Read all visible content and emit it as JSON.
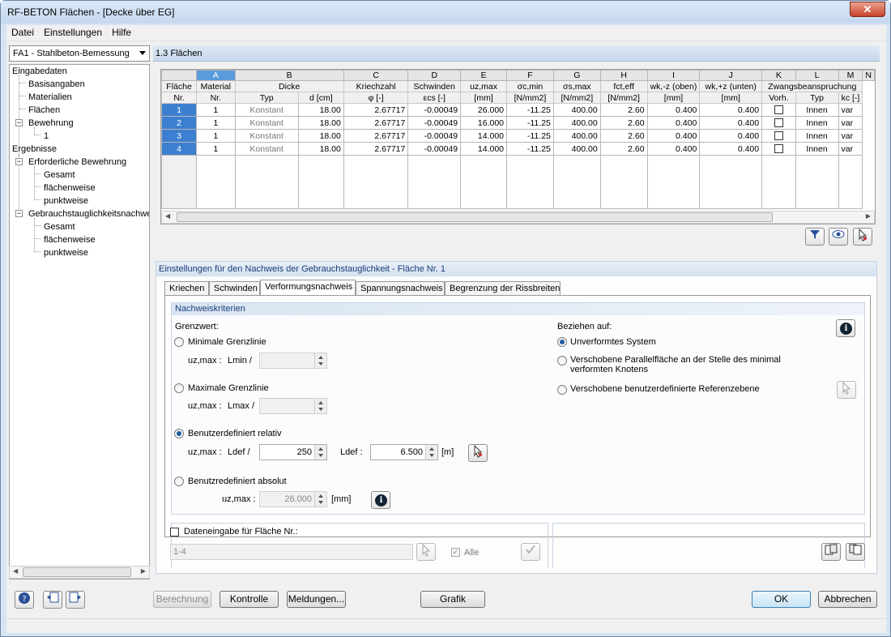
{
  "window": {
    "title": "RF-BETON Flächen - [Decke über EG]",
    "close": "✕"
  },
  "menu": [
    "Datei",
    "Einstellungen",
    "Hilfe"
  ],
  "case_selector": "FA1 - Stahlbeton-Bemessung",
  "nav": {
    "input_head": "Eingabedaten",
    "basis": "Basisangaben",
    "materials": "Materialien",
    "surfaces": "Flächen",
    "reinforcement": "Bewehrung",
    "reinf_1": "1",
    "results_head": "Ergebnisse",
    "req_reinf": "Erforderliche Bewehrung",
    "total1": "Gesamt",
    "surfacewise1": "flächenweise",
    "pointwise1": "punktweise",
    "serviceability": "Gebrauchstauglichkeitsnachweis",
    "total2": "Gesamt",
    "surfacewise2": "flächenweise",
    "pointwise2": "punktweise"
  },
  "section_title": "1.3 Flächen",
  "table": {
    "letters": [
      "A",
      "B",
      "C",
      "D",
      "E",
      "F",
      "G",
      "H",
      "I",
      "J",
      "K",
      "L",
      "M",
      "N"
    ],
    "h1": [
      "Fläche",
      "Material",
      "Dicke",
      "Kriechzahl",
      "Schwinden",
      "uz,max",
      "σc,min",
      "σs,max",
      "fct,eff",
      "wk,-z (oben)",
      "wk,+z (unten)",
      "Zwangsbeanspruchung"
    ],
    "h2": [
      "Nr.",
      "Nr.",
      "Typ",
      "d [cm]",
      "φ [-]",
      "εcs [-]",
      "[mm]",
      "[N/mm2]",
      "[N/mm2]",
      "[N/mm2]",
      "[mm]",
      "[mm]",
      "Vorh.",
      "Typ",
      "kc [-]"
    ],
    "rows": [
      [
        "1",
        "1",
        "Konstant",
        "18.00",
        "2.67717",
        "-0.00049",
        "26.000",
        "-11.25",
        "400.00",
        "2.60",
        "0.400",
        "0.400",
        "Innen",
        "var"
      ],
      [
        "2",
        "1",
        "Konstant",
        "18.00",
        "2.67717",
        "-0.00049",
        "16.000",
        "-11.25",
        "400.00",
        "2.60",
        "0.400",
        "0.400",
        "Innen",
        "var"
      ],
      [
        "3",
        "1",
        "Konstant",
        "18.00",
        "2.67717",
        "-0.00049",
        "14.000",
        "-11.25",
        "400.00",
        "2.60",
        "0.400",
        "0.400",
        "Innen",
        "var"
      ],
      [
        "4",
        "1",
        "Konstant",
        "18.00",
        "2.67717",
        "-0.00049",
        "14.000",
        "-11.25",
        "400.00",
        "2.60",
        "0.400",
        "0.400",
        "Innen",
        "var"
      ]
    ]
  },
  "settings": {
    "title": "Einstellungen für den Nachweis der Gebrauchstauglichkeit - Fläche Nr. 1",
    "tabs": [
      "Kriechen",
      "Schwinden",
      "Verformungsnachweis",
      "Spannungsnachweis",
      "Begrenzung der Rissbreiten"
    ],
    "group_title": "Nachweiskriterien",
    "grenzwert": "Grenzwert:",
    "opt_min": "Minimale Grenzlinie",
    "opt_max": "Maximale Grenzlinie",
    "opt_rel": "Benutzerdefiniert relativ",
    "opt_abs": "Benutzredefiniert absolut",
    "uzmax": "uz,max :",
    "lmin": "Lmin /",
    "lmax": "Lmax /",
    "ldef": "Ldef /",
    "ldef2": "Ldef :",
    "ldef_value": "250",
    "length_value": "6.500",
    "unit_m": "[m]",
    "abs_value": "26.000",
    "unit_mm": "[mm]",
    "ref_title": "Beziehen auf:",
    "ref1": "Unverformtes System",
    "ref2a": "Verschobene Parallelfläche an der Stelle des minimal",
    "ref2b": "verformten Knotens",
    "ref3": "Verschobene benutzerdefinierte Referenzebene",
    "data_input": "Dateneingabe für Fläche Nr.:",
    "data_value": "1-4",
    "all": "Alle"
  },
  "buttons": {
    "calc": "Berechnung",
    "control": "Kontrolle",
    "messages": "Meldungen...",
    "graphic": "Grafik",
    "ok": "OK",
    "cancel": "Abbrechen"
  }
}
